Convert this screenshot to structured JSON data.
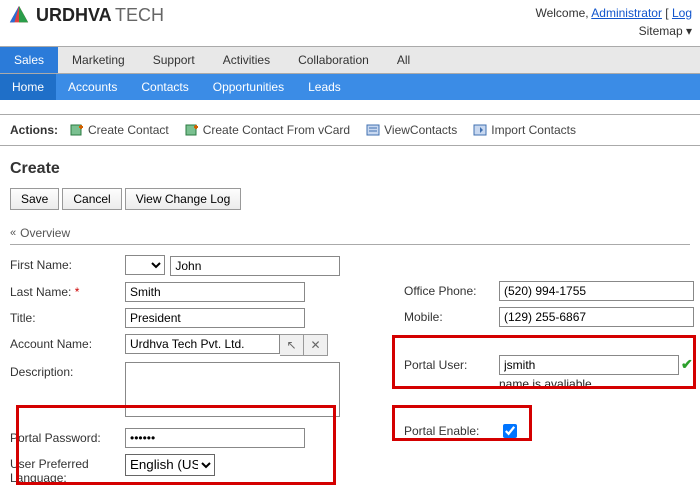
{
  "header": {
    "brand1": "URDHVA",
    "brand2": "TECH",
    "welcome_prefix": "Welcome, ",
    "admin_link": "Administrator",
    "log_link": "Log",
    "sitemap": "Sitemap",
    "sitemap_arrow": "▾"
  },
  "tabs": {
    "primary": [
      "Sales",
      "Marketing",
      "Support",
      "Activities",
      "Collaboration",
      "All"
    ],
    "secondary": [
      "Home",
      "Accounts",
      "Contacts",
      "Opportunities",
      "Leads"
    ]
  },
  "actions": {
    "label": "Actions:",
    "items": [
      "Create Contact",
      "Create Contact From vCard",
      "ViewContacts",
      "Import Contacts"
    ]
  },
  "page_title": "Create",
  "buttons": {
    "save": "Save",
    "cancel": "Cancel",
    "change_log": "View Change Log"
  },
  "section": {
    "overview": "Overview"
  },
  "fields": {
    "first_name_label": "First Name:",
    "first_name_value": "John",
    "last_name_label": "Last Name:",
    "last_name_value": "Smith",
    "title_label": "Title:",
    "title_value": "President",
    "account_label": "Account Name:",
    "account_value": "Urdhva Tech Pvt. Ltd.",
    "description_label": "Description:",
    "description_value": "",
    "portal_pw_label": "Portal Password:",
    "portal_pw_value": "••••••",
    "lang_label": "User Preferred Language:",
    "lang_value": "English (US)",
    "office_phone_label": "Office Phone:",
    "office_phone_value": "(520) 994-1755",
    "mobile_label": "Mobile:",
    "mobile_value": "(129) 255-6867",
    "portal_user_label": "Portal User:",
    "portal_user_value": "jsmith",
    "portal_user_msg": "name is avaliable.",
    "portal_enable_label": "Portal Enable:"
  }
}
